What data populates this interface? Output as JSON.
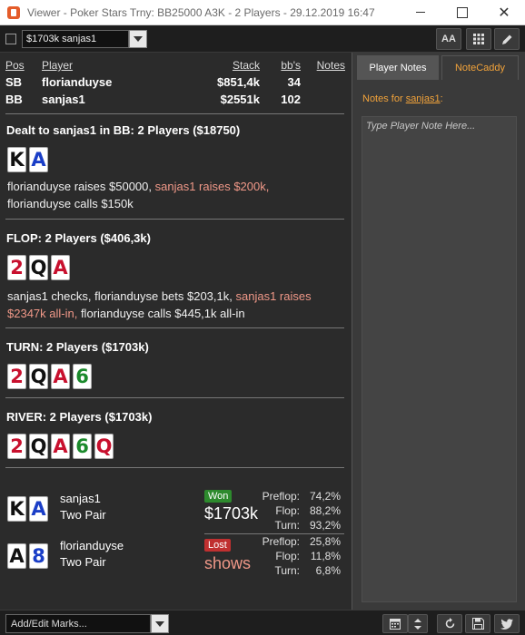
{
  "window": {
    "title": "Viewer - Poker Stars Trny: BB25000 A3K - 2 Players - 29.12.2019 16:47",
    "close_glyph": "✕"
  },
  "toolbar": {
    "hand_select_value": "$1703k sanjas1",
    "font_button": "AA",
    "grid_icon": "grid-icon",
    "edit_icon": "pencil-icon"
  },
  "positions": {
    "headers": {
      "pos": "Pos",
      "player": "Player",
      "stack": "Stack",
      "bbs": "bb's",
      "notes": "Notes"
    },
    "rows": [
      {
        "pos": "SB",
        "player": "florianduyse",
        "stack": "$851,4k",
        "bbs": "34"
      },
      {
        "pos": "BB",
        "player": "sanjas1",
        "stack": "$2551k",
        "bbs": "102"
      }
    ]
  },
  "preflop": {
    "title": "Dealt to sanjas1 in BB: 2 Players ($18750)",
    "cards": [
      {
        "r": "K",
        "s": "s"
      },
      {
        "r": "A",
        "s": "d"
      }
    ],
    "action_1": "florianduyse raises $50000, ",
    "action_hero": "sanjas1 raises $200k,",
    "action_2": "florianduyse calls $150k"
  },
  "flop": {
    "title": "FLOP: 2 Players ($406,3k)",
    "cards": [
      {
        "r": "2",
        "s": "h"
      },
      {
        "r": "Q",
        "s": "s"
      },
      {
        "r": "A",
        "s": "h"
      }
    ],
    "action_1": "sanjas1 checks, florianduyse bets $203,1k, ",
    "action_hero": "sanjas1 raises $2347k all-in,",
    "action_2": " florianduyse calls $445,1k all-in"
  },
  "turn": {
    "title": "TURN: 2 Players ($1703k)",
    "cards": [
      {
        "r": "2",
        "s": "h"
      },
      {
        "r": "Q",
        "s": "s"
      },
      {
        "r": "A",
        "s": "h"
      },
      {
        "r": "6",
        "s": "c"
      }
    ]
  },
  "river": {
    "title": "RIVER: 2 Players ($1703k)",
    "cards": [
      {
        "r": "2",
        "s": "h"
      },
      {
        "r": "Q",
        "s": "s"
      },
      {
        "r": "A",
        "s": "h"
      },
      {
        "r": "6",
        "s": "c"
      },
      {
        "r": "Q",
        "s": "h"
      }
    ]
  },
  "results": [
    {
      "player": "sanjas1",
      "hand": "Two Pair",
      "cards": [
        {
          "r": "K",
          "s": "s"
        },
        {
          "r": "A",
          "s": "d"
        }
      ],
      "badge": "Won",
      "amount": "$1703k",
      "equity": [
        {
          "label": "Preflop:",
          "value": "74,2%"
        },
        {
          "label": "Flop:",
          "value": "88,2%"
        },
        {
          "label": "Turn:",
          "value": "93,2%"
        }
      ]
    },
    {
      "player": "florianduyse",
      "hand": "Two Pair",
      "cards": [
        {
          "r": "A",
          "s": "s"
        },
        {
          "r": "8",
          "s": "d"
        }
      ],
      "badge": "Lost",
      "amount": "shows",
      "equity": [
        {
          "label": "Preflop:",
          "value": "25,8%"
        },
        {
          "label": "Flop:",
          "value": "11,8%"
        },
        {
          "label": "Turn:",
          "value": "6,8%"
        }
      ]
    }
  ],
  "sidebar": {
    "tab_notes": "Player Notes",
    "tab_caddy": "NoteCaddy",
    "notes_for_label": "Notes for ",
    "notes_for_player": "sanjas1",
    "notes_for_colon": ":",
    "note_placeholder": "Type Player Note Here..."
  },
  "bottom": {
    "marks_label": "Add/Edit Marks..."
  },
  "colors": {
    "hero_action": "#f09888",
    "accent": "#f2a33a",
    "won": "#2d8a2d",
    "lost": "#c03030"
  }
}
